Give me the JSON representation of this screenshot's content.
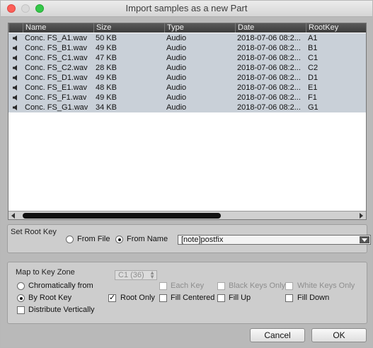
{
  "window": {
    "title": "Import samples as a new Part"
  },
  "columns": [
    {
      "label": "Name"
    },
    {
      "label": "Size"
    },
    {
      "label": "Type"
    },
    {
      "label": "Date"
    },
    {
      "label": "RootKey"
    }
  ],
  "files": [
    {
      "name": "Conc. FS_A1.wav",
      "size": "50 KB",
      "type": "Audio",
      "date": "2018-07-06 08:2...",
      "root": "A1"
    },
    {
      "name": "Conc. FS_B1.wav",
      "size": "49 KB",
      "type": "Audio",
      "date": "2018-07-06 08:2...",
      "root": "B1"
    },
    {
      "name": "Conc. FS_C1.wav",
      "size": "47 KB",
      "type": "Audio",
      "date": "2018-07-06 08:2...",
      "root": "C1"
    },
    {
      "name": "Conc. FS_C2.wav",
      "size": "28 KB",
      "type": "Audio",
      "date": "2018-07-06 08:2...",
      "root": "C2"
    },
    {
      "name": "Conc. FS_D1.wav",
      "size": "49 KB",
      "type": "Audio",
      "date": "2018-07-06 08:2...",
      "root": "D1"
    },
    {
      "name": "Conc. FS_E1.wav",
      "size": "48 KB",
      "type": "Audio",
      "date": "2018-07-06 08:2...",
      "root": "E1"
    },
    {
      "name": "Conc. FS_F1.wav",
      "size": "49 KB",
      "type": "Audio",
      "date": "2018-07-06 08:2...",
      "root": "F1"
    },
    {
      "name": "Conc. FS_G1.wav",
      "size": "34 KB",
      "type": "Audio",
      "date": "2018-07-06 08:2...",
      "root": "G1"
    }
  ],
  "root_key": {
    "title": "Set Root Key",
    "from_file": "From File",
    "from_name": "From Name",
    "selected": "from_name",
    "pattern": "[note]postfix"
  },
  "key_zone": {
    "title": "Map to Key Zone",
    "chromatically": "Chromatically from",
    "by_root_key": "By Root Key",
    "selected": "by_root_key",
    "start_key": "C1 (36)",
    "each_key": "Each Key",
    "black_keys_only": "Black Keys Only",
    "white_keys_only": "White Keys Only",
    "root_only": "Root Only",
    "root_only_checked": true,
    "fill_centered": "Fill Centered",
    "fill_up": "Fill Up",
    "fill_down": "Fill Down",
    "distribute_vertically": "Distribute Vertically"
  },
  "buttons": {
    "cancel": "Cancel",
    "ok": "OK"
  },
  "icons": {
    "file_row": "speaker-icon"
  }
}
